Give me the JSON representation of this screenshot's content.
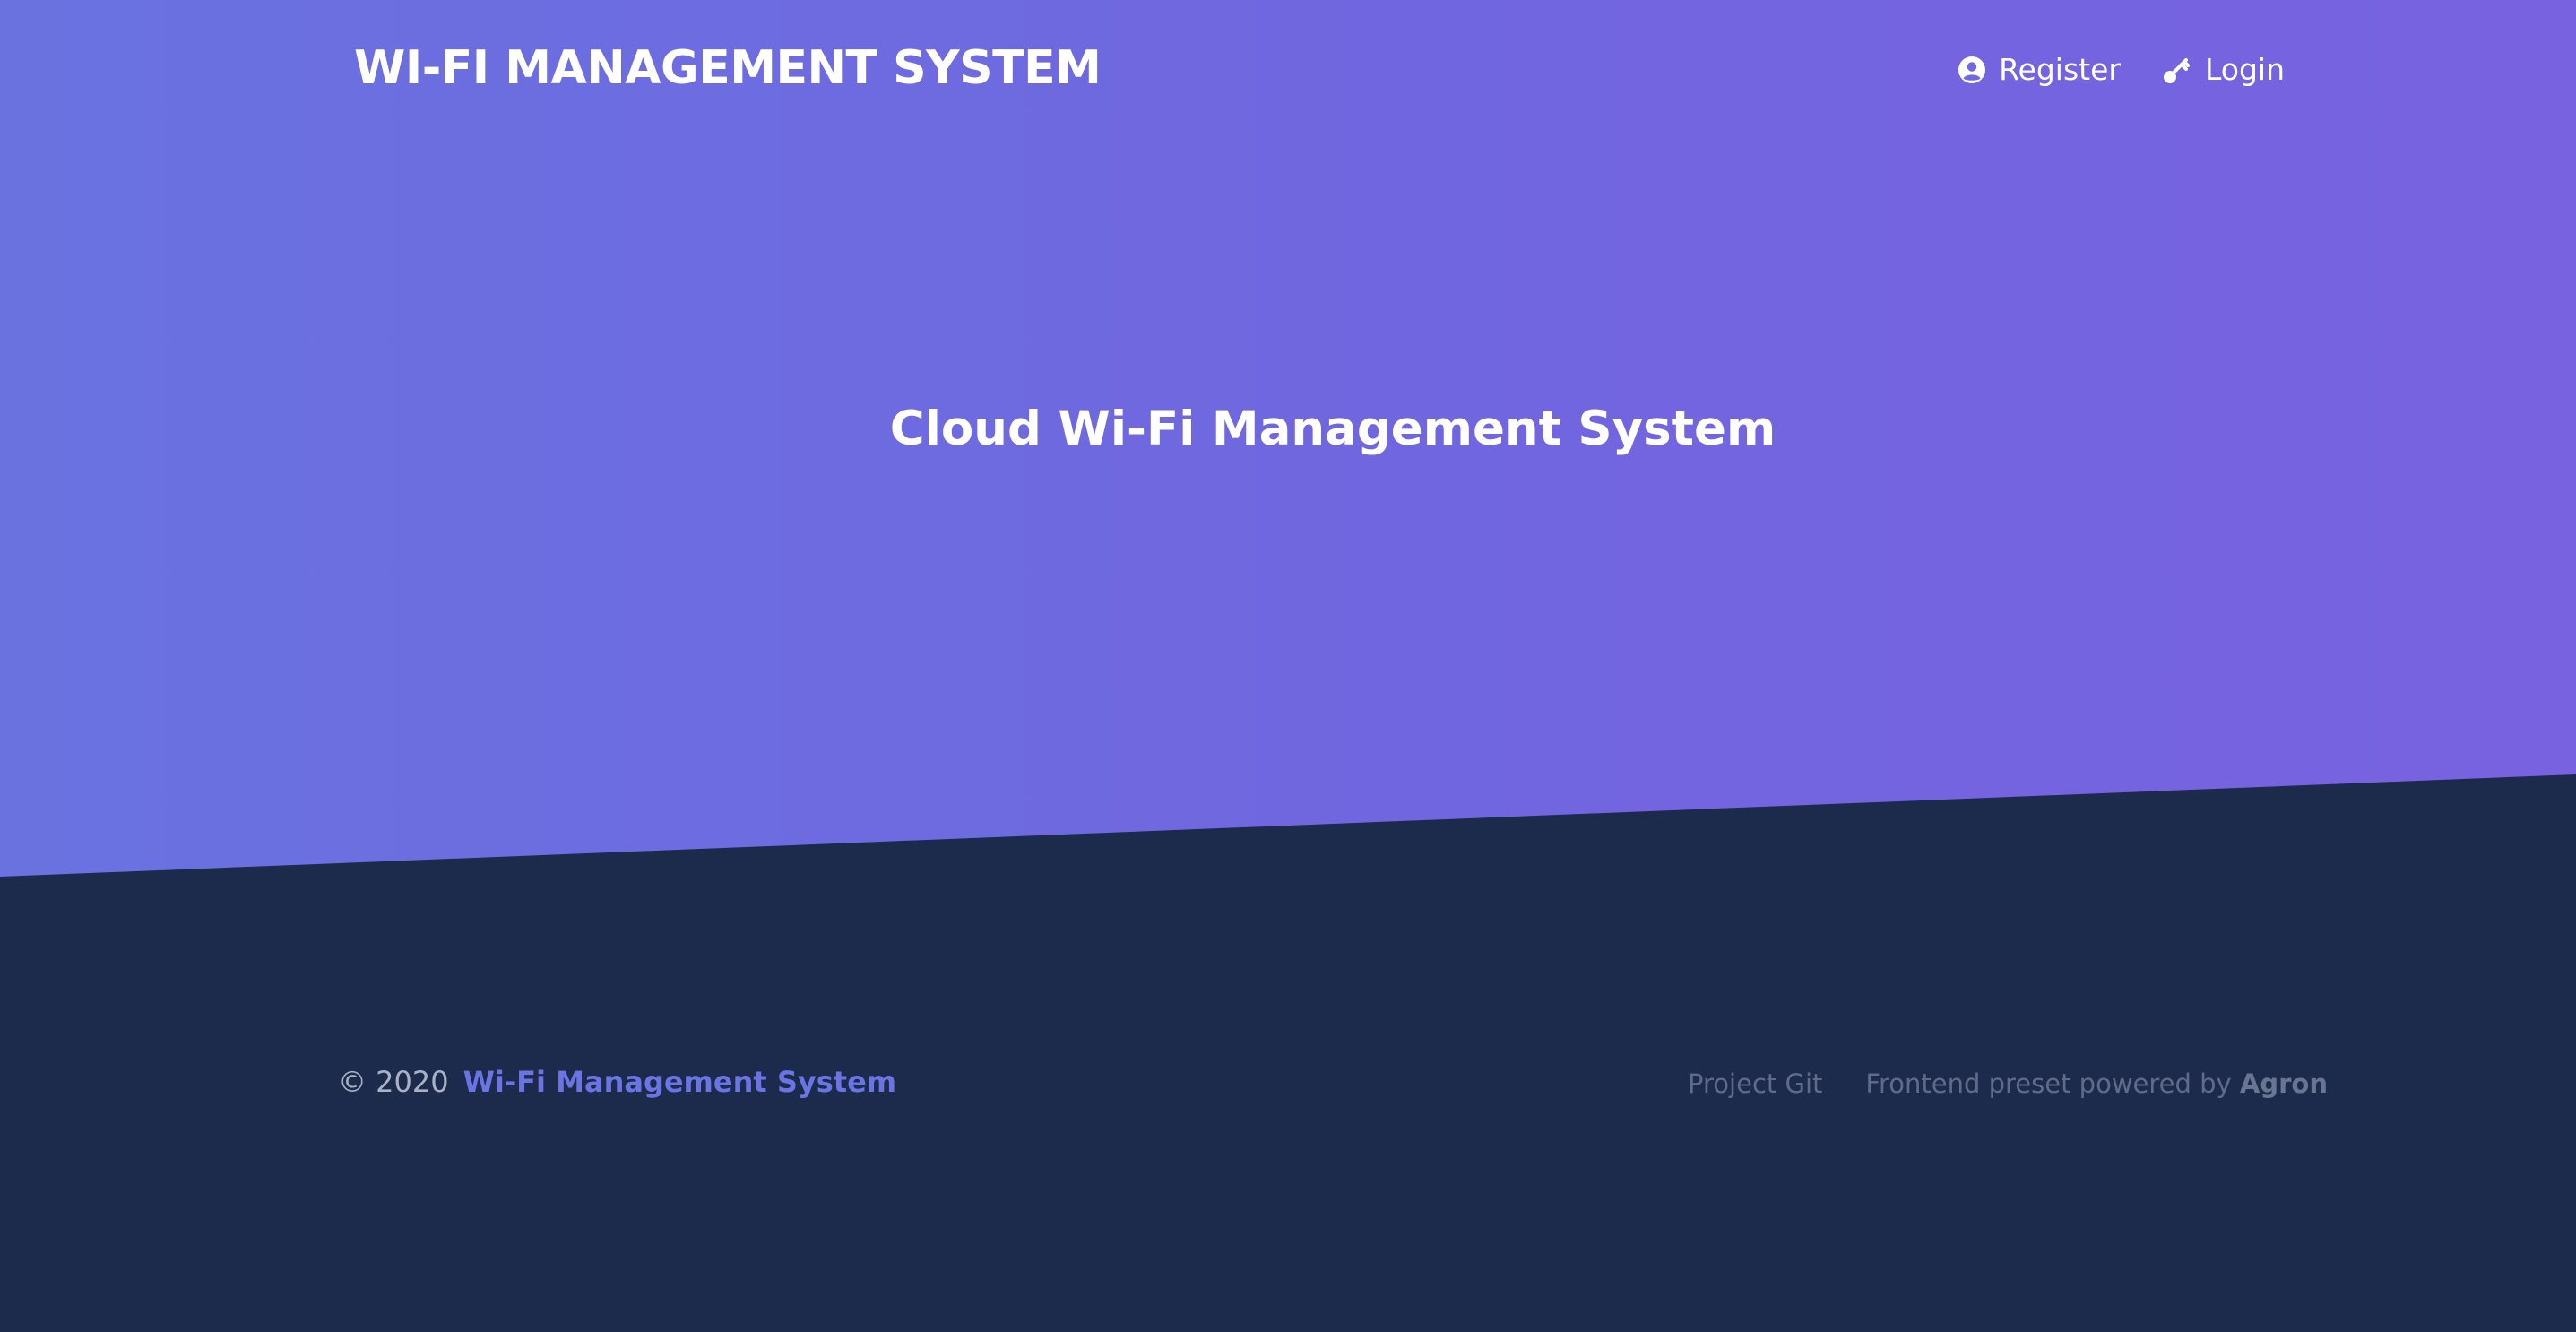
{
  "header": {
    "brand": "WI-FI MANAGEMENT SYSTEM",
    "nav": {
      "register_label": "Register",
      "register_icon": "user-circle-icon",
      "login_label": "Login",
      "login_icon": "key-icon"
    }
  },
  "hero": {
    "title": "Cloud Wi-Fi Management System"
  },
  "footer": {
    "copyright": "© 2020",
    "brand_link": "Wi-Fi Management System",
    "project_git": "Project Git",
    "powered_text": "Frontend preset powered by",
    "powered_brand": "Agron"
  },
  "colors": {
    "hero_gradient_start": "#6a72e0",
    "hero_gradient_end": "#7862e0",
    "footer_background": "#1c2a4c",
    "accent": "#6b74e3"
  }
}
